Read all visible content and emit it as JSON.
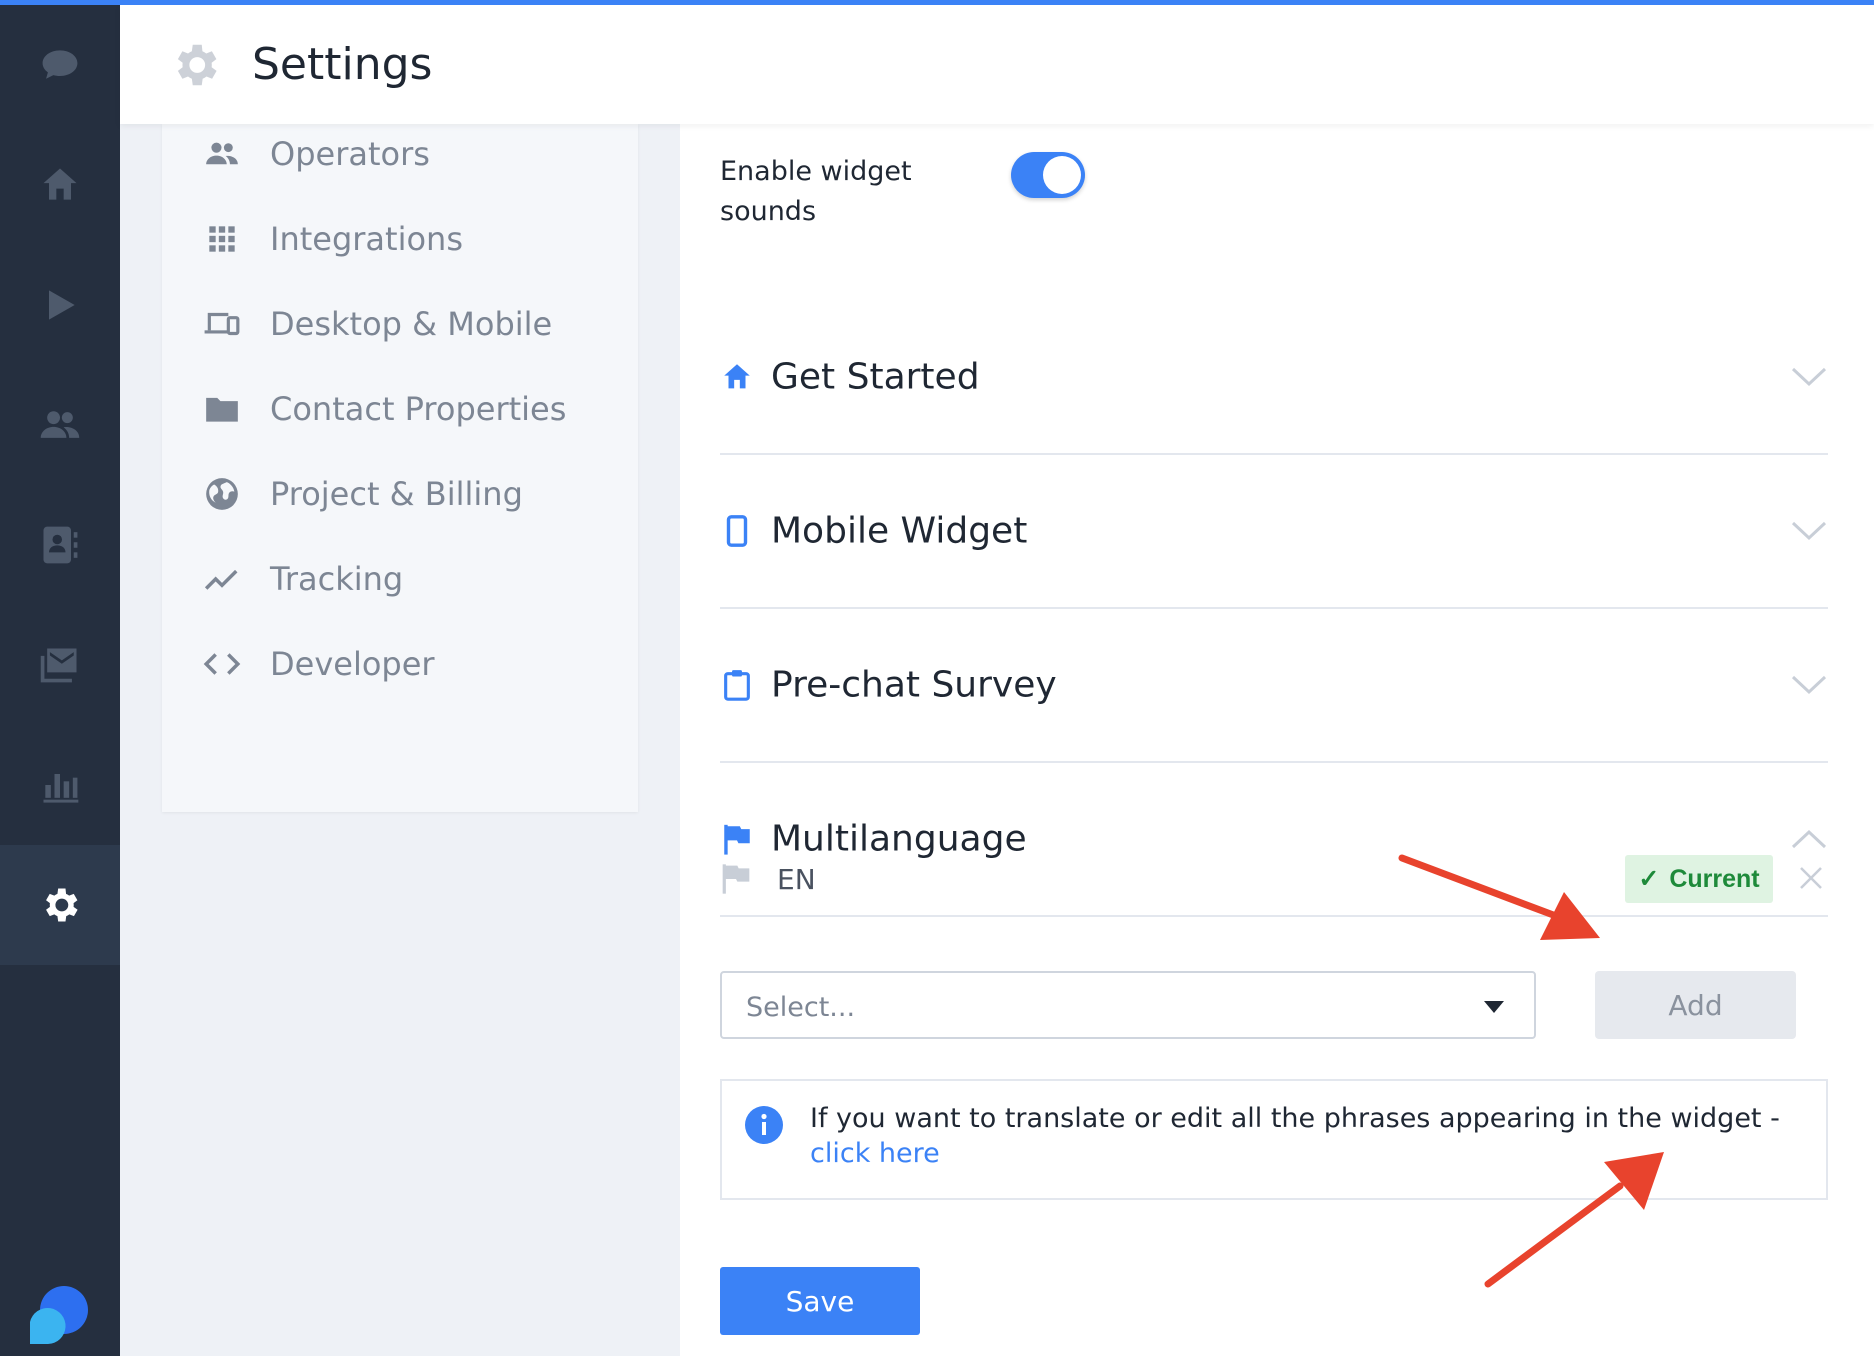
{
  "header": {
    "title": "Settings",
    "icon": "gear-icon"
  },
  "rail": {
    "items": [
      {
        "name": "chat-icon"
      },
      {
        "name": "home-icon"
      },
      {
        "name": "play-icon"
      },
      {
        "name": "users-icon"
      },
      {
        "name": "contacts-icon"
      },
      {
        "name": "inbox-icon"
      },
      {
        "name": "analytics-icon"
      },
      {
        "name": "gear-icon",
        "active": true
      }
    ]
  },
  "submenu": {
    "items": [
      {
        "label": "Operators",
        "icon": "people-icon"
      },
      {
        "label": "Integrations",
        "icon": "grid-icon"
      },
      {
        "label": "Desktop & Mobile",
        "icon": "devices-icon"
      },
      {
        "label": "Contact Properties",
        "icon": "folder-icon"
      },
      {
        "label": "Project & Billing",
        "icon": "globe-icon"
      },
      {
        "label": "Tracking",
        "icon": "trend-icon"
      },
      {
        "label": "Developer",
        "icon": "code-icon"
      }
    ]
  },
  "main": {
    "toggle_label": "Enable widget sounds",
    "toggle_on": true,
    "sections": [
      {
        "title": "Get Started",
        "icon": "home-icon",
        "expanded": false
      },
      {
        "title": "Mobile Widget",
        "icon": "phone-icon",
        "expanded": false
      },
      {
        "title": "Pre-chat Survey",
        "icon": "clipboard-icon",
        "expanded": false
      },
      {
        "title": "Multilanguage",
        "icon": "flag-icon",
        "expanded": true
      }
    ],
    "language": {
      "code": "EN",
      "badge": "Current"
    },
    "select_placeholder": "Select...",
    "add_label": "Add",
    "info": {
      "text": "If you want to translate or edit all the phrases appearing in the widget -",
      "link": "click here"
    },
    "save_label": "Save"
  },
  "colors": {
    "rail_bg": "#252f3f",
    "accent": "#3b82f6",
    "badge_bg": "#dff3e2",
    "badge_text": "#1e8a3a",
    "arrow": "#e8432d"
  }
}
